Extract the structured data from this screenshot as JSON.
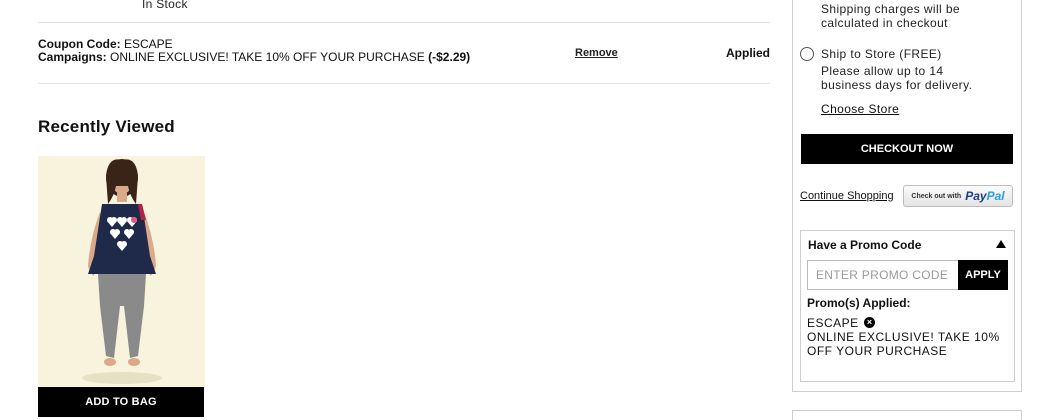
{
  "cart_item": {
    "stock_status": "In Stock"
  },
  "coupon": {
    "code_label": "Coupon Code:",
    "code_value": "ESCAPE",
    "campaign_label": "Campaigns:",
    "campaign_value": "ONLINE EXCLUSIVE! TAKE 10% OFF YOUR PURCHASE",
    "discount": "(-$2.29)",
    "remove_label": "Remove",
    "status": "Applied"
  },
  "recently_viewed": {
    "title": "Recently Viewed",
    "add_to_bag_label": "ADD TO BAG"
  },
  "shipping": {
    "note_line1": "Shipping charges will be",
    "note_line2": "calculated in checkout",
    "ship_to_store_label": "Ship to Store (FREE)",
    "ship_to_store_desc_line1": "Please allow up to 14",
    "ship_to_store_desc_line2": "business days for delivery.",
    "choose_store_label": "Choose Store"
  },
  "actions": {
    "checkout_label": "CHECKOUT NOW",
    "continue_label": "Continue Shopping",
    "paypal_small": "Check out with",
    "paypal_pay": "Pay",
    "paypal_pal": "Pal"
  },
  "promo": {
    "title": "Have a Promo Code",
    "input_placeholder": "ENTER PROMO CODE",
    "input_value": "",
    "apply_label": "APPLY",
    "applied_title": "Promo(s) Applied:",
    "applied_code": "ESCAPE",
    "applied_desc": "ONLINE EXCLUSIVE! TAKE 10% OFF YOUR PURCHASE"
  },
  "icons": {
    "promo_toggle": "caret-up-icon",
    "remove_promo": "remove-circle-icon",
    "shipping_radio": "radio-empty"
  },
  "colors": {
    "button_bg": "#000000",
    "button_text": "#ffffff",
    "paypal_dark": "#1a3b8a",
    "paypal_light": "#2b9fdc",
    "divider": "#e2e2e2",
    "panel_border": "#cfcfcf"
  }
}
